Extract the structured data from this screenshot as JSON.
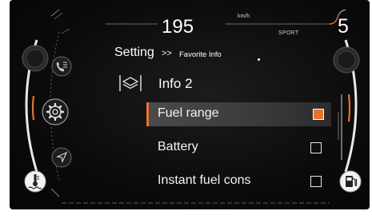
{
  "status_bar": {
    "speed": "195",
    "speed_unit": "km/h",
    "drive_mode": "SPORT",
    "gear": "5"
  },
  "breadcrumb": {
    "title": "Setting",
    "separator": ">>",
    "current": "Favorite Info"
  },
  "section": {
    "title": "Info 2",
    "icon": "layers-icon"
  },
  "menu": {
    "items": [
      {
        "label": "Fuel range",
        "checked": true,
        "selected": true
      },
      {
        "label": "Battery",
        "checked": false,
        "selected": false
      },
      {
        "label": "Instant fuel cons",
        "checked": false,
        "selected": false
      }
    ]
  },
  "sidebar_icons": [
    "phone-list-icon",
    "settings-gear-icon",
    "navigation-arrow-icon",
    "coolant-temperature-icon",
    "fuel-pump-icon"
  ],
  "colors": {
    "accent": "#e8732a",
    "background": "#0b0b0c",
    "text": "#f2f2f2"
  }
}
